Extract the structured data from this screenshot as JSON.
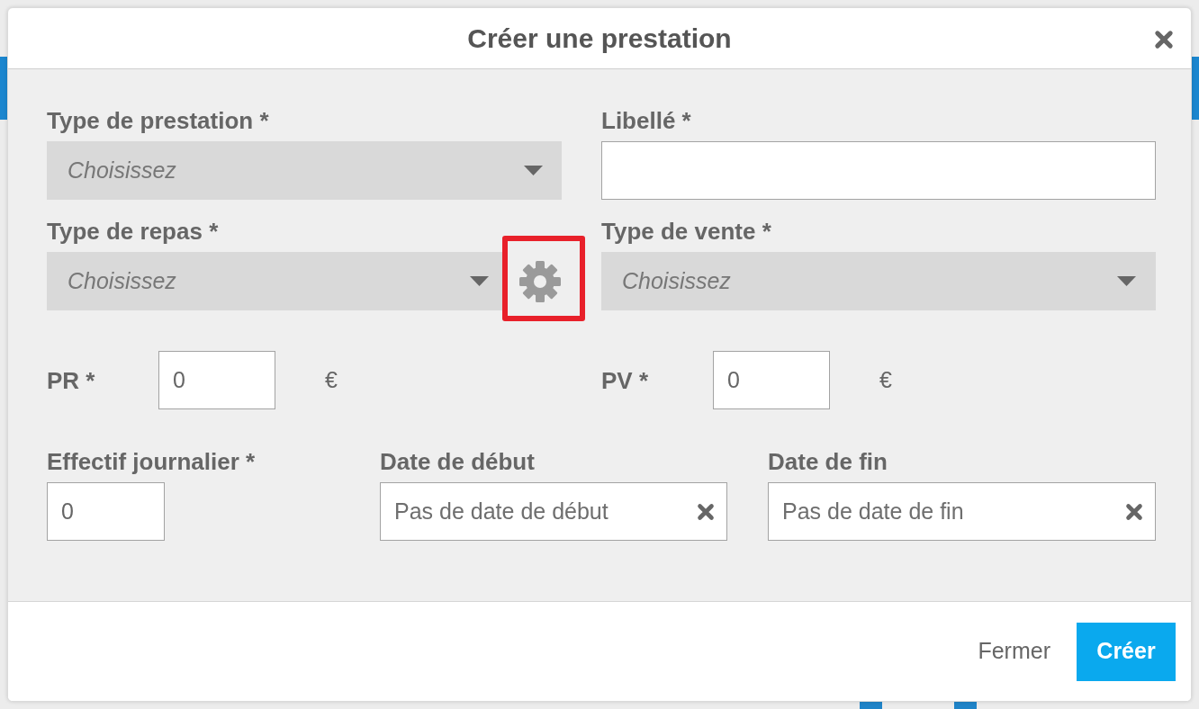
{
  "dialog": {
    "title": "Créer une prestation"
  },
  "form": {
    "service_type": {
      "label": "Type de prestation *",
      "placeholder": "Choisissez"
    },
    "label_field": {
      "label": "Libellé *"
    },
    "meal_type": {
      "label": "Type de repas *",
      "placeholder": "Choisissez",
      "settings": {
        "highlighted": true
      }
    },
    "sale_type": {
      "label": "Type de vente *",
      "placeholder": "Choisissez"
    },
    "prices": [
      {
        "label": "PR *",
        "value": "0",
        "unit": "€"
      },
      {
        "label": "PV *",
        "value": "0",
        "unit": "€"
      }
    ],
    "daily_headcount": {
      "label": "Effectif journalier *",
      "value": "0"
    },
    "dates": [
      {
        "label": "Date de début",
        "placeholder": "Pas de date de début"
      },
      {
        "label": "Date de fin",
        "placeholder": "Pas de date de fin"
      }
    ]
  },
  "footer": {
    "buttons": [
      {
        "kind": "secondary",
        "label": "Fermer"
      },
      {
        "kind": "primary",
        "label": "Créer"
      }
    ]
  }
}
